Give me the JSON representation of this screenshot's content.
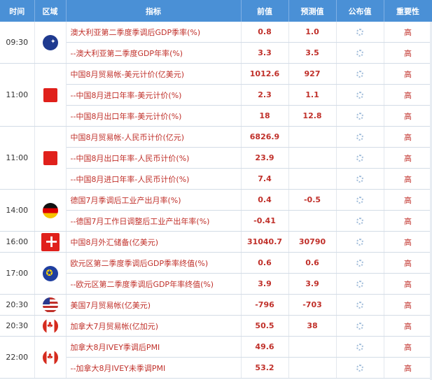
{
  "headers": {
    "time": "时间",
    "region": "区域",
    "indicator": "指标",
    "previous": "前值",
    "forecast": "预测值",
    "actual": "公布值",
    "importance": "重要性"
  },
  "colors": {
    "header_bg": "#4a90d6",
    "accent": "#c0302a"
  },
  "rows": [
    {
      "time": "09:30",
      "flag": "australia-flag-icon",
      "indicator": "澳大利亚第二季度季调后GDP季率(%)",
      "previous": "0.8",
      "forecast": "1.0",
      "importance": "高"
    },
    {
      "indicator": "--澳大利亚第二季度GDP年率(%)",
      "previous": "3.3",
      "forecast": "3.5",
      "importance": "高"
    },
    {
      "time": "11:00",
      "flag": "china-flag-icon",
      "indicator": "中国8月贸易帐-美元计价(亿美元)",
      "previous": "1012.6",
      "forecast": "927",
      "importance": "高"
    },
    {
      "indicator": "--中国8月进口年率-美元计价(%)",
      "previous": "2.3",
      "forecast": "1.1",
      "importance": "高"
    },
    {
      "indicator": "--中国8月出口年率-美元计价(%)",
      "previous": "18",
      "forecast": "12.8",
      "importance": "高"
    },
    {
      "time": "11:00",
      "flag": "china-flag-icon",
      "indicator": "中国8月贸易帐-人民币计价(亿元)",
      "previous": "6826.9",
      "forecast": "",
      "importance": "高"
    },
    {
      "indicator": "--中国8月出口年率-人民币计价(%)",
      "previous": "23.9",
      "forecast": "",
      "importance": "高"
    },
    {
      "indicator": "--中国8月进口年率-人民币计价(%)",
      "previous": "7.4",
      "forecast": "",
      "importance": "高"
    },
    {
      "time": "14:00",
      "flag": "germany-flag-icon",
      "indicator": "德国7月季调后工业产出月率(%)",
      "previous": "0.4",
      "forecast": "-0.5",
      "importance": "高"
    },
    {
      "indicator": "--德国7月工作日调整后工业产出年率(%)",
      "previous": "-0.41",
      "forecast": "",
      "importance": "高"
    },
    {
      "time": "16:00",
      "flag": "switzerland-flag-icon",
      "indicator": "中国8月外汇储备(亿美元)",
      "previous": "31040.7",
      "forecast": "30790",
      "importance": "高"
    },
    {
      "time": "17:00",
      "flag": "eu-flag-icon",
      "indicator": "欧元区第二季度季调后GDP季率终值(%)",
      "previous": "0.6",
      "forecast": "0.6",
      "importance": "高"
    },
    {
      "indicator": "--欧元区第二季度季调后GDP年率终值(%)",
      "previous": "3.9",
      "forecast": "3.9",
      "importance": "高"
    },
    {
      "time": "20:30",
      "flag": "usa-flag-icon",
      "indicator": "美国7月贸易帐(亿美元)",
      "previous": "-796",
      "forecast": "-703",
      "importance": "高"
    },
    {
      "time": "20:30",
      "flag": "canada-flag-icon",
      "indicator": "加拿大7月贸易帐(亿加元)",
      "previous": "50.5",
      "forecast": "38",
      "importance": "高"
    },
    {
      "time": "22:00",
      "flag": "canada-flag-icon",
      "indicator": "加拿大8月IVEY季调后PMI",
      "previous": "49.6",
      "forecast": "",
      "importance": "高"
    },
    {
      "indicator": "--加拿大8月IVEY未季调PMI",
      "previous": "53.2",
      "forecast": "",
      "importance": "高"
    }
  ]
}
